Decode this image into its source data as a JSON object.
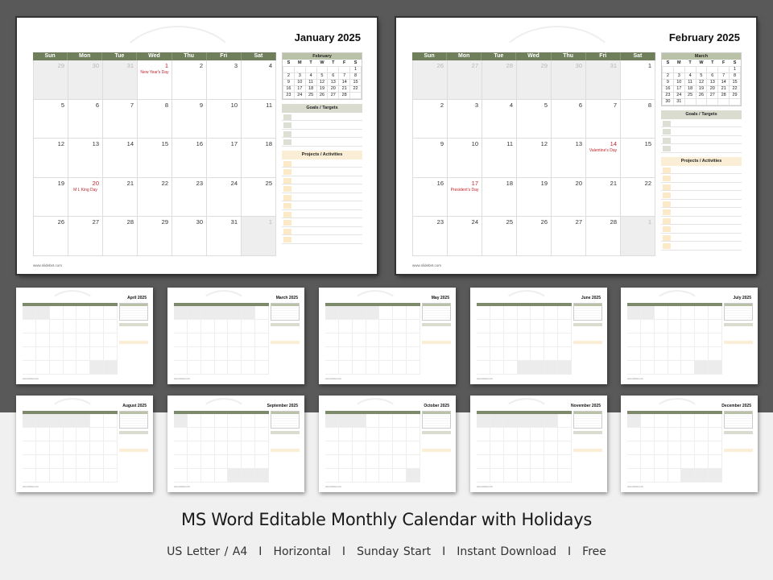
{
  "headline": "MS Word Editable Monthly Calendar with Holidays",
  "features": [
    "US Letter / A4",
    "Horizontal",
    "Sunday Start",
    "Instant Download",
    "Free"
  ],
  "separator": "I",
  "weekdays": [
    "Sun",
    "Mon",
    "Tue",
    "Wed",
    "Thu",
    "Fri",
    "Sat"
  ],
  "mini_weekdays": [
    "S",
    "M",
    "T",
    "W",
    "T",
    "F",
    "S"
  ],
  "goals_label": "Goals / Targets",
  "projects_label": "Projects / Activities",
  "footer_url": "www.slidebet.com",
  "colors": {
    "header_green": "#6f7f5c",
    "holiday_red": "#c0272d",
    "goals_bg": "#d9dccf",
    "projects_bg": "#fbeed6",
    "backdrop": "#595959"
  },
  "featured_pages": [
    {
      "title": "January 2025",
      "weeks": [
        [
          {
            "d": "29",
            "o": 1
          },
          {
            "d": "30",
            "o": 1
          },
          {
            "d": "31",
            "o": 1
          },
          {
            "d": "1",
            "hol": "New Year's Day"
          },
          {
            "d": "2"
          },
          {
            "d": "3"
          },
          {
            "d": "4"
          }
        ],
        [
          {
            "d": "5"
          },
          {
            "d": "6"
          },
          {
            "d": "7"
          },
          {
            "d": "8"
          },
          {
            "d": "9"
          },
          {
            "d": "10"
          },
          {
            "d": "11"
          }
        ],
        [
          {
            "d": "12"
          },
          {
            "d": "13"
          },
          {
            "d": "14"
          },
          {
            "d": "15"
          },
          {
            "d": "16"
          },
          {
            "d": "17"
          },
          {
            "d": "18"
          }
        ],
        [
          {
            "d": "19"
          },
          {
            "d": "20",
            "hol": "M L King Day"
          },
          {
            "d": "21"
          },
          {
            "d": "22"
          },
          {
            "d": "23"
          },
          {
            "d": "24"
          },
          {
            "d": "25"
          }
        ],
        [
          {
            "d": "26"
          },
          {
            "d": "27"
          },
          {
            "d": "28"
          },
          {
            "d": "29"
          },
          {
            "d": "30"
          },
          {
            "d": "31"
          },
          {
            "d": "1",
            "o": 1
          }
        ]
      ],
      "mini": {
        "title": "February",
        "rows": [
          [
            "",
            "",
            "",
            "",
            "",
            "",
            "1"
          ],
          [
            "2",
            "3",
            "4",
            "5",
            "6",
            "7",
            "8"
          ],
          [
            "9",
            "10",
            "11",
            "12",
            "13",
            "14",
            "15"
          ],
          [
            "16",
            "17",
            "18",
            "19",
            "20",
            "21",
            "22"
          ],
          [
            "23",
            "24",
            "25",
            "26",
            "27",
            "28",
            ""
          ]
        ]
      }
    },
    {
      "title": "February 2025",
      "weeks": [
        [
          {
            "d": "26",
            "o": 1
          },
          {
            "d": "27",
            "o": 1
          },
          {
            "d": "28",
            "o": 1
          },
          {
            "d": "29",
            "o": 1
          },
          {
            "d": "30",
            "o": 1
          },
          {
            "d": "31",
            "o": 1
          },
          {
            "d": "1"
          }
        ],
        [
          {
            "d": "2"
          },
          {
            "d": "3"
          },
          {
            "d": "4"
          },
          {
            "d": "5"
          },
          {
            "d": "6"
          },
          {
            "d": "7"
          },
          {
            "d": "8"
          }
        ],
        [
          {
            "d": "9"
          },
          {
            "d": "10"
          },
          {
            "d": "11"
          },
          {
            "d": "12"
          },
          {
            "d": "13"
          },
          {
            "d": "14",
            "hol": "Valentine's Day"
          },
          {
            "d": "15"
          }
        ],
        [
          {
            "d": "16"
          },
          {
            "d": "17",
            "hol": "President's Day"
          },
          {
            "d": "18"
          },
          {
            "d": "19"
          },
          {
            "d": "20"
          },
          {
            "d": "21"
          },
          {
            "d": "22"
          }
        ],
        [
          {
            "d": "23"
          },
          {
            "d": "24"
          },
          {
            "d": "25"
          },
          {
            "d": "26"
          },
          {
            "d": "27"
          },
          {
            "d": "28"
          },
          {
            "d": "1",
            "o": 1
          }
        ]
      ],
      "mini": {
        "title": "March",
        "rows": [
          [
            "",
            "",
            "",
            "",
            "",
            "",
            "1"
          ],
          [
            "2",
            "3",
            "4",
            "5",
            "6",
            "7",
            "8"
          ],
          [
            "9",
            "10",
            "11",
            "12",
            "13",
            "14",
            "15"
          ],
          [
            "16",
            "17",
            "18",
            "19",
            "20",
            "21",
            "22"
          ],
          [
            "23",
            "24",
            "25",
            "26",
            "27",
            "28",
            "29"
          ],
          [
            "30",
            "31",
            "",
            "",
            "",
            "",
            ""
          ]
        ]
      }
    }
  ],
  "thumbnails": [
    {
      "title": "April 2025"
    },
    {
      "title": "March 2025"
    },
    {
      "title": "May 2025"
    },
    {
      "title": "June 2025"
    },
    {
      "title": "July 2025"
    },
    {
      "title": "August 2025"
    },
    {
      "title": "September 2025"
    },
    {
      "title": "October 2025"
    },
    {
      "title": "November 2025"
    },
    {
      "title": "December 2025"
    }
  ]
}
